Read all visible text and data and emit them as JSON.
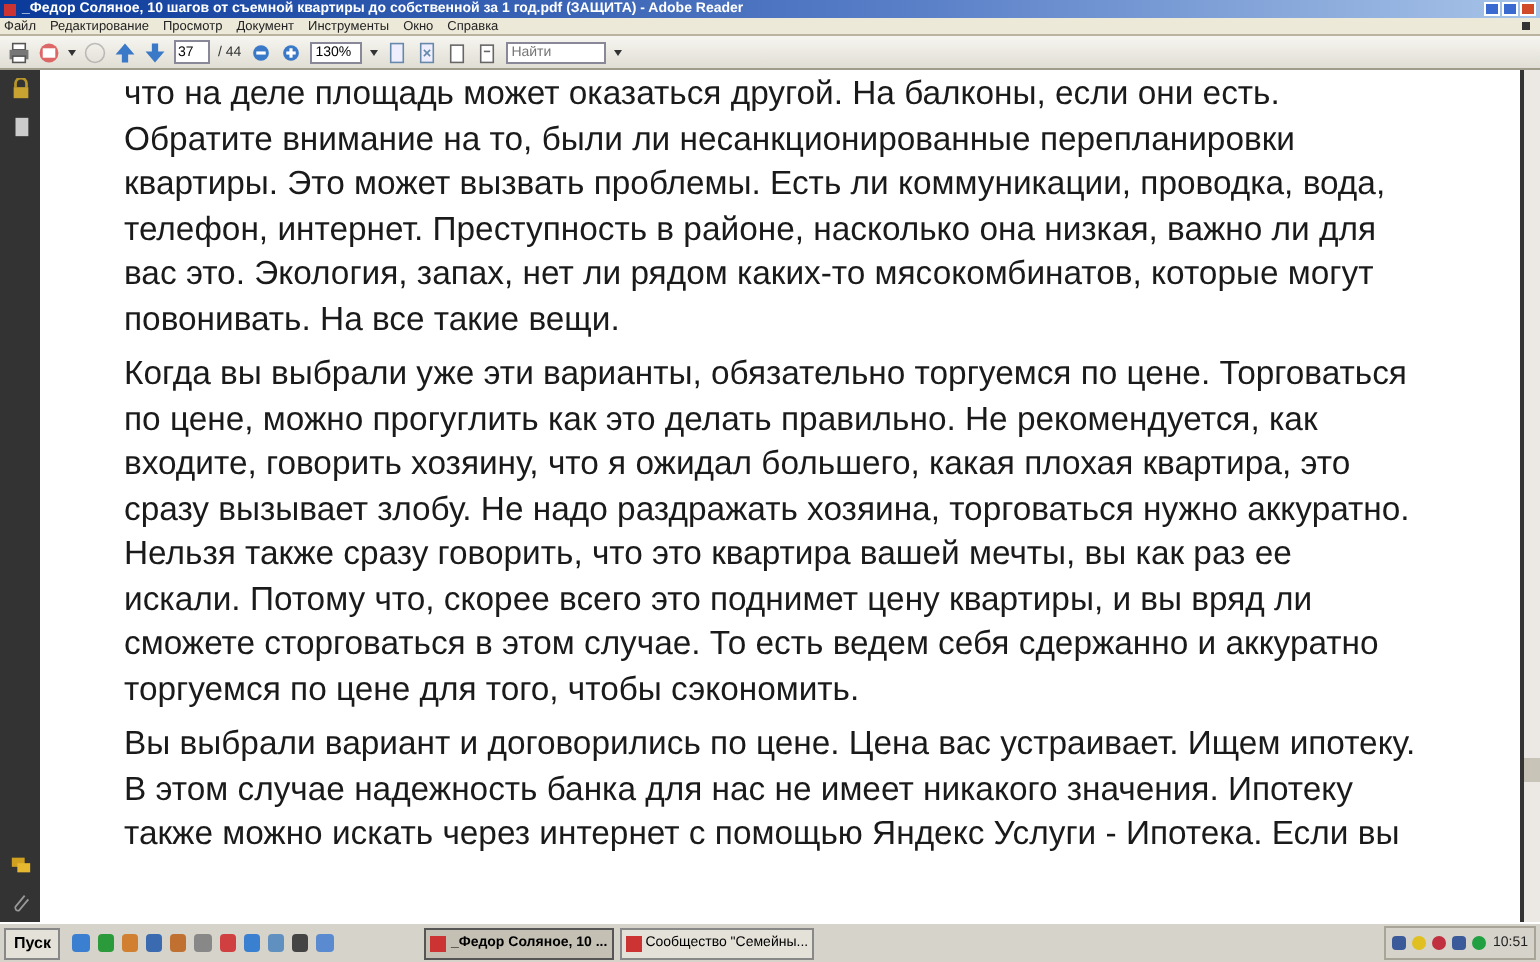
{
  "window": {
    "title": "_Федор Соляное, 10 шагов от съемной квартиры до  собственной за 1 год.pdf (ЗАЩИТА) - Adobe Reader"
  },
  "menu": [
    "Файл",
    "Редактирование",
    "Просмотр",
    "Документ",
    "Инструменты",
    "Окно",
    "Справка"
  ],
  "toolbar": {
    "page": "37",
    "page_total": "/ 44",
    "zoom": "130%",
    "search": {
      "placeholder": "Найти"
    }
  },
  "document": {
    "paragraphs": [
      [
        "что на деле площадь может оказаться другой. На балконы,  если они есть.",
        "Обратите внимание  на то, были ли несанкционированные перепланировки",
        "квартиры. Это может вызвать проблемы. Есть  ли коммуникации, проводка, вода,",
        "телефон, интернет. Преступность в районе,  насколько она низкая, важно ли для",
        "вас это. Экология,  запах, нет ли рядом каких-то мясокомбинатов, которые могут",
        "повонивать. На все такие вещи."
      ],
      [
        "Когда вы выбрали уже эти варианты,  обязательно торгуемся по цене. Торговаться",
        "по цене, можно прогуглить как это делать правильно. Не рекомендуется,  как",
        "входите,  говорить хозяину, что я ожидал большего, какая плохая квартира, это",
        "сразу вызывает злобу. Не надо раздражать хозяина, торговаться нужно аккуратно.",
        "Нельзя также сразу говорить, что  это квартира вашей мечты, вы как раз ее",
        "искали. Потому что, скорее всего это  поднимет цену квартиры, и вы вряд ли",
        "сможете сторговаться в этом случае. То есть ведем себя сдержанно и аккуратно",
        "торгуемся по цене для того, чтобы сэкономить."
      ],
      [
        "Вы выбрали вариант и договорились по цене. Цена вас устраивает. Ищем ипотеку.",
        "В этом случае надежность банка для нас не имеет никакого значения. Ипотеку",
        "также можно искать  через интернет с помощью Яндекс Услуги - Ипотека. Если вы"
      ]
    ]
  },
  "taskbar": {
    "start": "Пуск",
    "tasks": [
      {
        "label": "_Федор Соляное, 10 ...",
        "selected": true
      },
      {
        "label": "Сообщество \"Семейны...",
        "selected": false
      }
    ],
    "clock": "10:51"
  }
}
